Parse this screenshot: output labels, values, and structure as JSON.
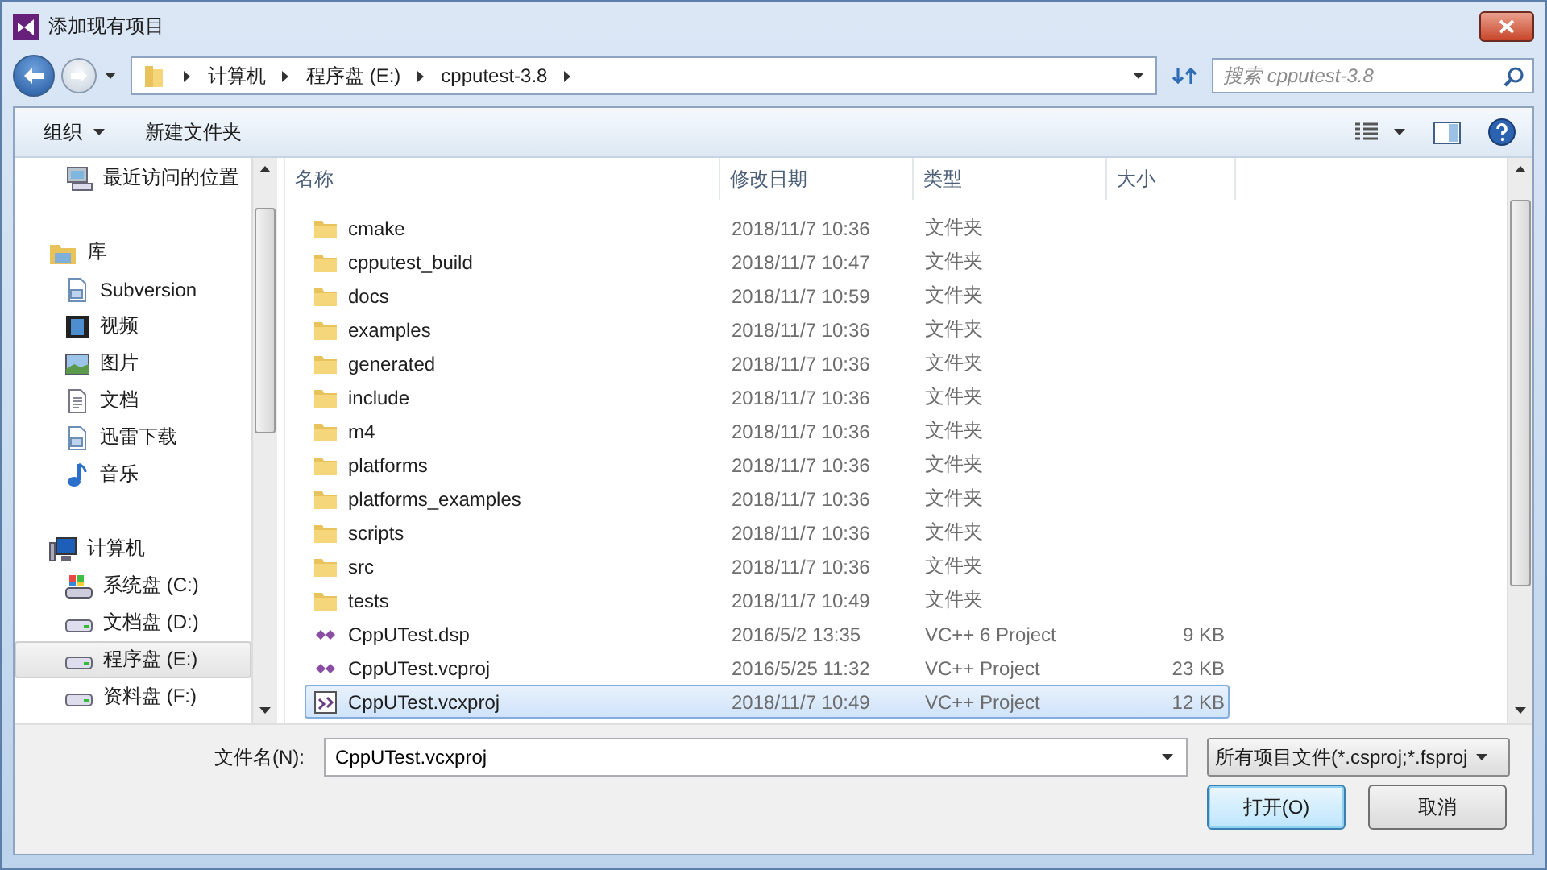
{
  "window": {
    "title": "添加现有项目"
  },
  "nav": {
    "breadcrumbs": [
      "计算机",
      "程序盘 (E:)",
      "cpputest-3.8"
    ],
    "search": {
      "placeholder": "搜索 cpputest-3.8"
    }
  },
  "toolbar": {
    "buttons": [
      {
        "label": "组织",
        "kind": "menu"
      },
      {
        "label": "新建文件夹",
        "kind": "plain"
      }
    ]
  },
  "sidebar": {
    "sections": [
      {
        "children": [
          {
            "label": "最近访问的位置",
            "kind": "recent",
            "selected": false
          }
        ]
      },
      {
        "label": "库",
        "kind": "library",
        "children": [
          {
            "label": "Subversion",
            "kind": "doc",
            "selected": false
          },
          {
            "label": "视频",
            "kind": "video",
            "selected": false
          },
          {
            "label": "图片",
            "kind": "picture",
            "selected": false
          },
          {
            "label": "文档",
            "kind": "text",
            "selected": false
          },
          {
            "label": "迅雷下载",
            "kind": "doc",
            "selected": false
          },
          {
            "label": "音乐",
            "kind": "music",
            "selected": false
          }
        ]
      },
      {
        "label": "计算机",
        "kind": "computer",
        "children": [
          {
            "label": "系统盘 (C:)",
            "kind": "sysdrive",
            "selected": false
          },
          {
            "label": "文档盘 (D:)",
            "kind": "drive",
            "selected": false
          },
          {
            "label": "程序盘 (E:)",
            "kind": "drive",
            "selected": true
          },
          {
            "label": "资料盘 (F:)",
            "kind": "drive",
            "selected": false
          }
        ]
      }
    ]
  },
  "table": {
    "columns": [
      "名称",
      "修改日期",
      "类型",
      "大小"
    ],
    "rows": [
      {
        "name": "cmake",
        "date": "2018/11/7 10:36",
        "type": "文件夹",
        "kind": "folder",
        "selected": false
      },
      {
        "name": "cpputest_build",
        "date": "2018/11/7 10:47",
        "type": "文件夹",
        "kind": "folder",
        "selected": false
      },
      {
        "name": "docs",
        "date": "2018/11/7 10:59",
        "type": "文件夹",
        "kind": "folder",
        "selected": false
      },
      {
        "name": "examples",
        "date": "2018/11/7 10:36",
        "type": "文件夹",
        "kind": "folder",
        "selected": false
      },
      {
        "name": "generated",
        "date": "2018/11/7 10:36",
        "type": "文件夹",
        "kind": "folder",
        "selected": false
      },
      {
        "name": "include",
        "date": "2018/11/7 10:36",
        "type": "文件夹",
        "kind": "folder",
        "selected": false
      },
      {
        "name": "m4",
        "date": "2018/11/7 10:36",
        "type": "文件夹",
        "kind": "folder",
        "selected": false
      },
      {
        "name": "platforms",
        "date": "2018/11/7 10:36",
        "type": "文件夹",
        "kind": "folder",
        "selected": false
      },
      {
        "name": "platforms_examples",
        "date": "2018/11/7 10:36",
        "type": "文件夹",
        "kind": "folder",
        "selected": false
      },
      {
        "name": "scripts",
        "date": "2018/11/7 10:36",
        "type": "文件夹",
        "kind": "folder",
        "selected": false
      },
      {
        "name": "src",
        "date": "2018/11/7 10:36",
        "type": "文件夹",
        "kind": "folder",
        "selected": false
      },
      {
        "name": "tests",
        "date": "2018/11/7 10:49",
        "type": "文件夹",
        "kind": "folder",
        "selected": false
      },
      {
        "name": "CppUTest.dsp",
        "date": "2016/5/2 13:35",
        "type": "VC++ 6 Project",
        "size": "9 KB",
        "kind": "project",
        "selected": false
      },
      {
        "name": "CppUTest.vcproj",
        "date": "2016/5/25 11:32",
        "type": "VC++ Project",
        "size": "23 KB",
        "kind": "project",
        "selected": false
      },
      {
        "name": "CppUTest.vcxproj",
        "date": "2018/11/7 10:49",
        "type": "VC++ Project",
        "size": "12 KB",
        "kind": "vcxproj",
        "selected": true
      }
    ]
  },
  "footer": {
    "filename_label": "文件名(N):",
    "filename": "CppUTest.vcxproj",
    "filter": "所有项目文件(*.csproj;*.fsproj",
    "buttons": [
      {
        "label": "打开(O)",
        "default": true
      },
      {
        "label": "取消",
        "default": false
      }
    ]
  }
}
